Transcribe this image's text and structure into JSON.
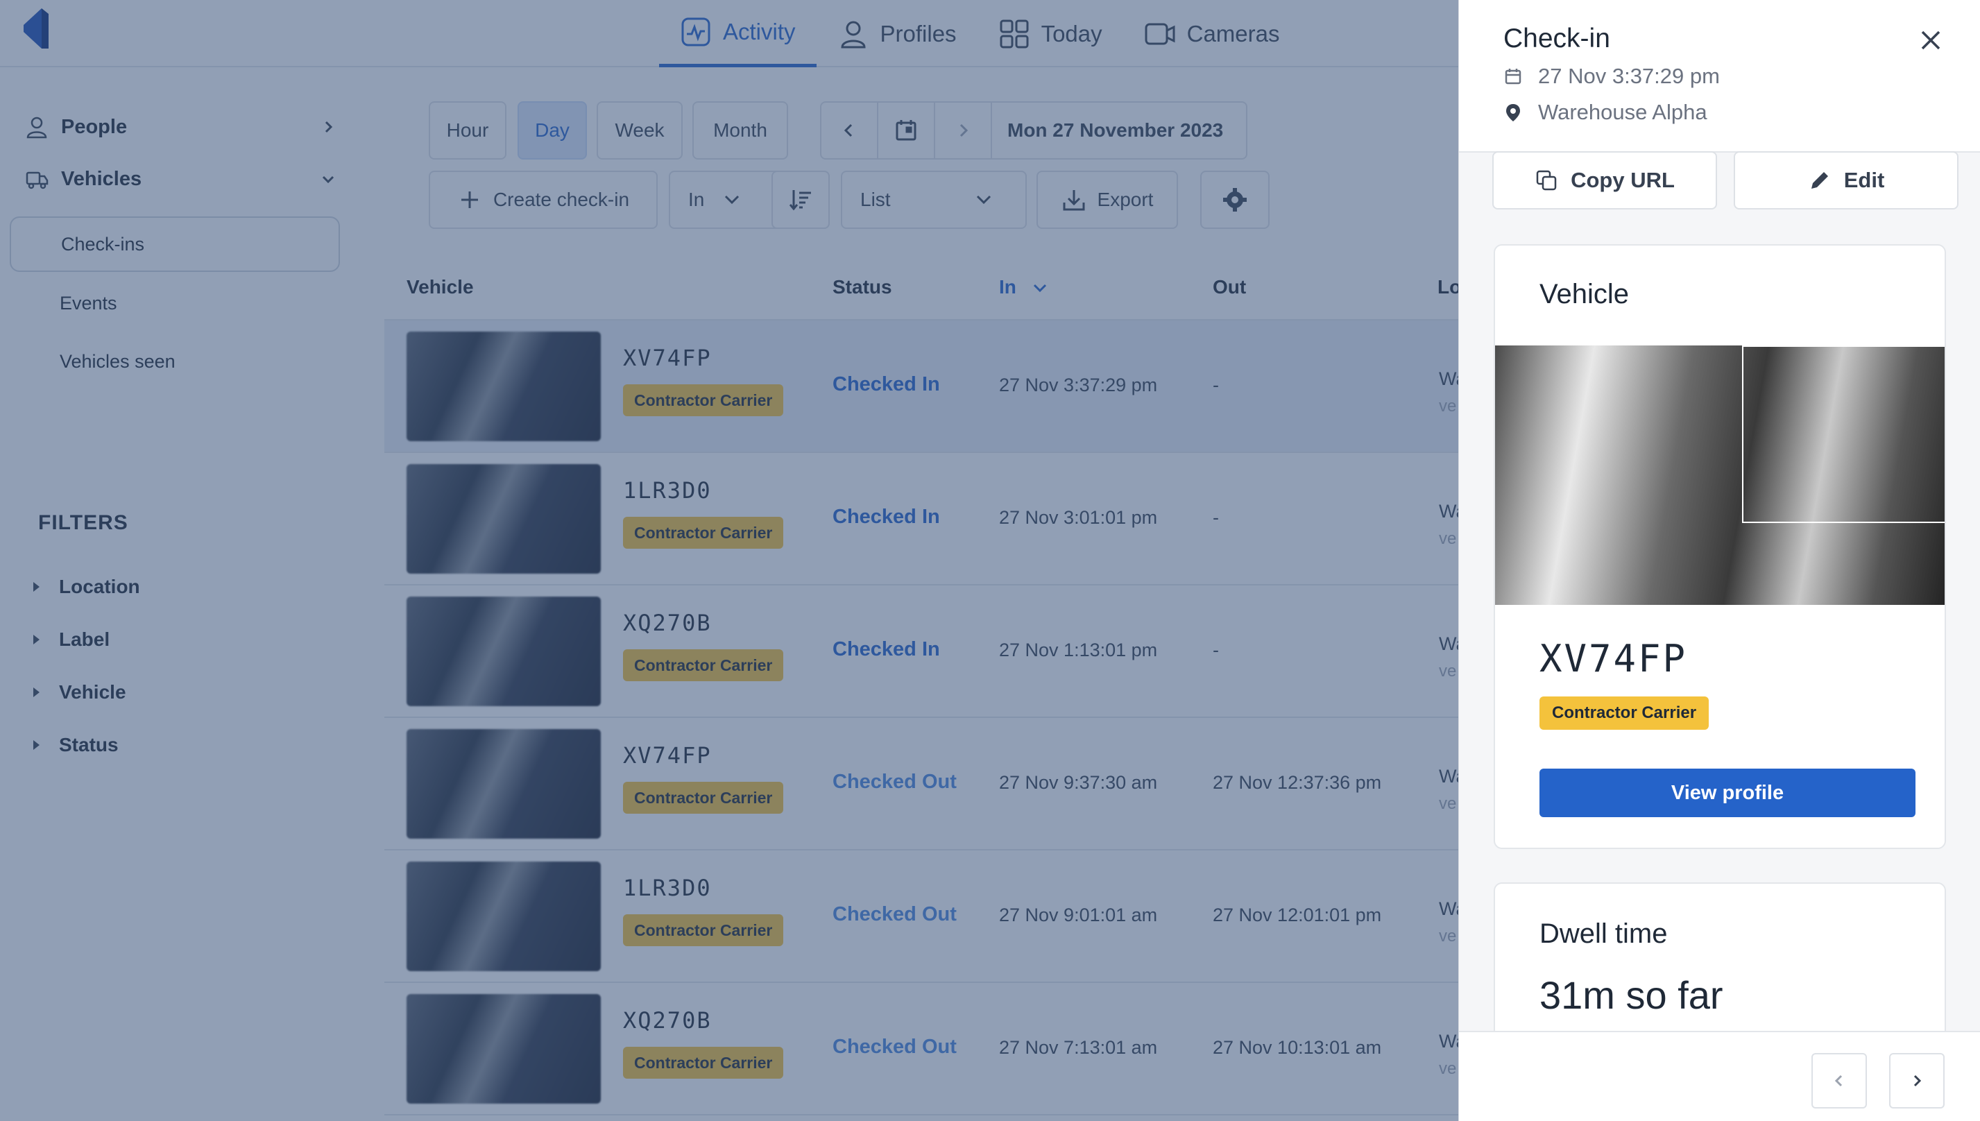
{
  "nav": {
    "tabs": [
      {
        "label": "Activity",
        "active": true
      },
      {
        "label": "Profiles"
      },
      {
        "label": "Today"
      },
      {
        "label": "Cameras"
      }
    ]
  },
  "sidebar": {
    "people": "People",
    "vehicles": "Vehicles",
    "sub": [
      "Check-ins",
      "Events",
      "Vehicles seen"
    ],
    "filters_title": "FILTERS",
    "filters": [
      "Location",
      "Label",
      "Vehicle",
      "Status"
    ]
  },
  "toolbar": {
    "ranges": [
      "Hour",
      "Day",
      "Week",
      "Month"
    ],
    "active_range": "Day",
    "date": "Mon 27 November 2023",
    "create": "Create check-in",
    "direction": "In",
    "view": "List",
    "export": "Export"
  },
  "table": {
    "headers": {
      "vehicle": "Vehicle",
      "status": "Status",
      "in": "In",
      "out": "Out",
      "location": "Lo"
    },
    "rows": [
      {
        "plate": "XV74FP",
        "tag": "Contractor Carrier",
        "status": "Checked In",
        "in": "27 Nov 3:37:29 pm",
        "out": "-",
        "loc1": "Wa",
        "loc2": "ve"
      },
      {
        "plate": "1LR3D0",
        "tag": "Contractor Carrier",
        "status": "Checked In",
        "in": "27 Nov 3:01:01 pm",
        "out": "-",
        "loc1": "Wa",
        "loc2": "ve"
      },
      {
        "plate": "XQ270B",
        "tag": "Contractor Carrier",
        "status": "Checked In",
        "in": "27 Nov 1:13:01 pm",
        "out": "-",
        "loc1": "Wa",
        "loc2": "ve"
      },
      {
        "plate": "XV74FP",
        "tag": "Contractor Carrier",
        "status": "Checked Out",
        "in": "27 Nov 9:37:30 am",
        "out": "27 Nov 12:37:36 pm",
        "loc1": "Wa",
        "loc2": "ve"
      },
      {
        "plate": "1LR3D0",
        "tag": "Contractor Carrier",
        "status": "Checked Out",
        "in": "27 Nov 9:01:01 am",
        "out": "27 Nov 12:01:01 pm",
        "loc1": "Wa",
        "loc2": "ve"
      },
      {
        "plate": "XQ270B",
        "tag": "Contractor Carrier",
        "status": "Checked Out",
        "in": "27 Nov 7:13:01 am",
        "out": "27 Nov 10:13:01 am",
        "loc1": "Wa",
        "loc2": "ve"
      }
    ]
  },
  "panel": {
    "title": "Check-in",
    "datetime": "27 Nov 3:37:29 pm",
    "location": "Warehouse Alpha",
    "copy_url": "Copy URL",
    "edit": "Edit",
    "vehicle_title": "Vehicle",
    "plate": "XV74FP",
    "tag": "Contractor Carrier",
    "view_profile": "View profile",
    "dwell_title": "Dwell time",
    "dwell_value": "31m so far"
  },
  "colors": {
    "accent": "#2563c9",
    "tag": "#f4c23c",
    "overlay": "#375078"
  }
}
